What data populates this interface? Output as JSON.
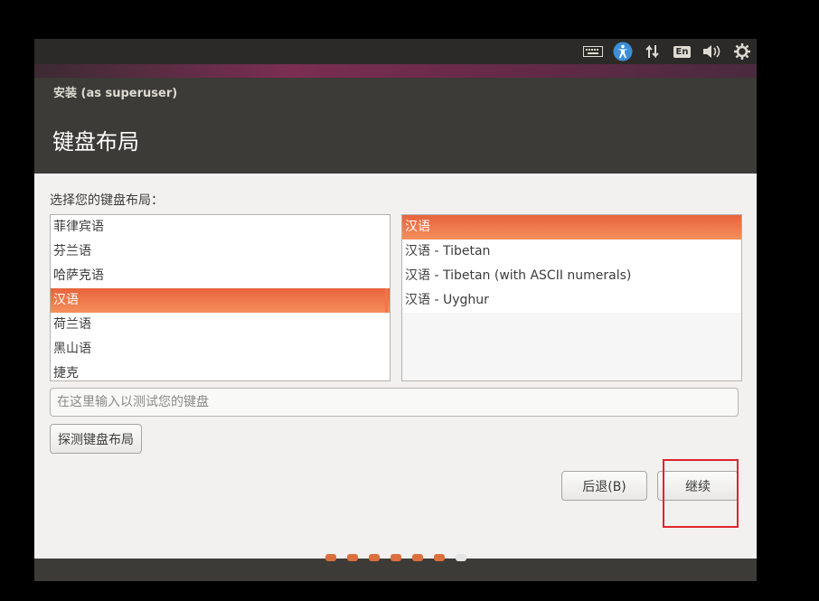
{
  "window": {
    "title": "安装 (as superuser)"
  },
  "header": {
    "title": "键盘布局"
  },
  "prompt": "选择您的键盘布局：",
  "layouts": {
    "items": [
      "菲律宾语",
      "芬兰语",
      "哈萨克语",
      "汉语",
      "荷兰语",
      "黑山语",
      "捷克"
    ],
    "selected_index": 3
  },
  "variants": {
    "items": [
      "汉语",
      "汉语 - Tibetan",
      "汉语 - Tibetan (with ASCII numerals)",
      "汉语 - Uyghur"
    ],
    "selected_index": 0
  },
  "test_input": {
    "placeholder": "在这里输入以测试您的键盘",
    "value": ""
  },
  "buttons": {
    "detect": "探测键盘布局",
    "back": "后退(B)",
    "continue": "继续"
  },
  "tray": {
    "language": "En",
    "icons": [
      "keyboard-icon",
      "accessibility-icon",
      "network-icon",
      "language-icon",
      "volume-icon",
      "gear-icon"
    ]
  },
  "progress": {
    "total_steps": 7,
    "current_step": 7
  },
  "colors": {
    "accent": "#f07746",
    "highlight": "#e0242c",
    "panel": "#3c3b37"
  }
}
